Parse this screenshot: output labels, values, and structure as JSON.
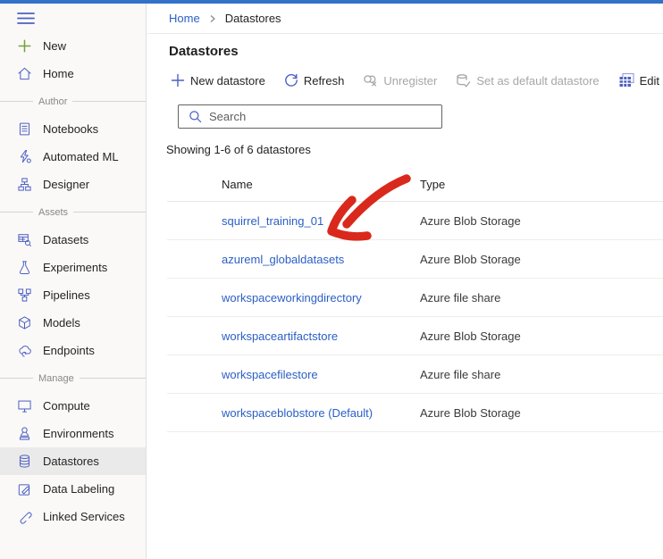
{
  "accent": {
    "topbar_color": "#3272c8",
    "link_color": "#2b5fc4",
    "sidebar_icon_color": "#4d60c2",
    "new_icon_color": "#73a33c",
    "annotation_color": "#d9291c"
  },
  "sidebar": {
    "sections": [
      {
        "items": [
          {
            "label": "New"
          },
          {
            "label": "Home"
          }
        ]
      },
      {
        "title": "Author",
        "items": [
          {
            "label": "Notebooks"
          },
          {
            "label": "Automated ML"
          },
          {
            "label": "Designer"
          }
        ]
      },
      {
        "title": "Assets",
        "items": [
          {
            "label": "Datasets"
          },
          {
            "label": "Experiments"
          },
          {
            "label": "Pipelines"
          },
          {
            "label": "Models"
          },
          {
            "label": "Endpoints"
          }
        ]
      },
      {
        "title": "Manage",
        "items": [
          {
            "label": "Compute"
          },
          {
            "label": "Environments"
          },
          {
            "label": "Datastores",
            "selected": true
          },
          {
            "label": "Data Labeling"
          },
          {
            "label": "Linked Services"
          }
        ]
      }
    ]
  },
  "breadcrumb": {
    "items": [
      "Home",
      "Datastores"
    ]
  },
  "page": {
    "title": "Datastores"
  },
  "toolbar": {
    "items": [
      {
        "label": "New datastore",
        "enabled": true
      },
      {
        "label": "Refresh",
        "enabled": true
      },
      {
        "label": "Unregister",
        "enabled": false
      },
      {
        "label": "Set as default datastore",
        "enabled": false
      },
      {
        "label": "Edit",
        "enabled": true
      }
    ]
  },
  "search": {
    "placeholder": "Search"
  },
  "status": {
    "text": "Showing 1-6 of 6 datastores"
  },
  "table": {
    "columns": [
      "Name",
      "Type"
    ],
    "rows": [
      {
        "name": "squirrel_training_01",
        "type": "Azure Blob Storage"
      },
      {
        "name": "azureml_globaldatasets",
        "type": "Azure Blob Storage"
      },
      {
        "name": "workspaceworkingdirectory",
        "type": "Azure file share"
      },
      {
        "name": "workspaceartifactstore",
        "type": "Azure Blob Storage"
      },
      {
        "name": "workspacefilestore",
        "type": "Azure file share"
      },
      {
        "name": "workspaceblobstore (Default)",
        "type": "Azure Blob Storage"
      }
    ]
  },
  "annotation": {
    "type": "hand-drawn arrow",
    "color": "#d9291c",
    "target": "squirrel_training_01"
  }
}
